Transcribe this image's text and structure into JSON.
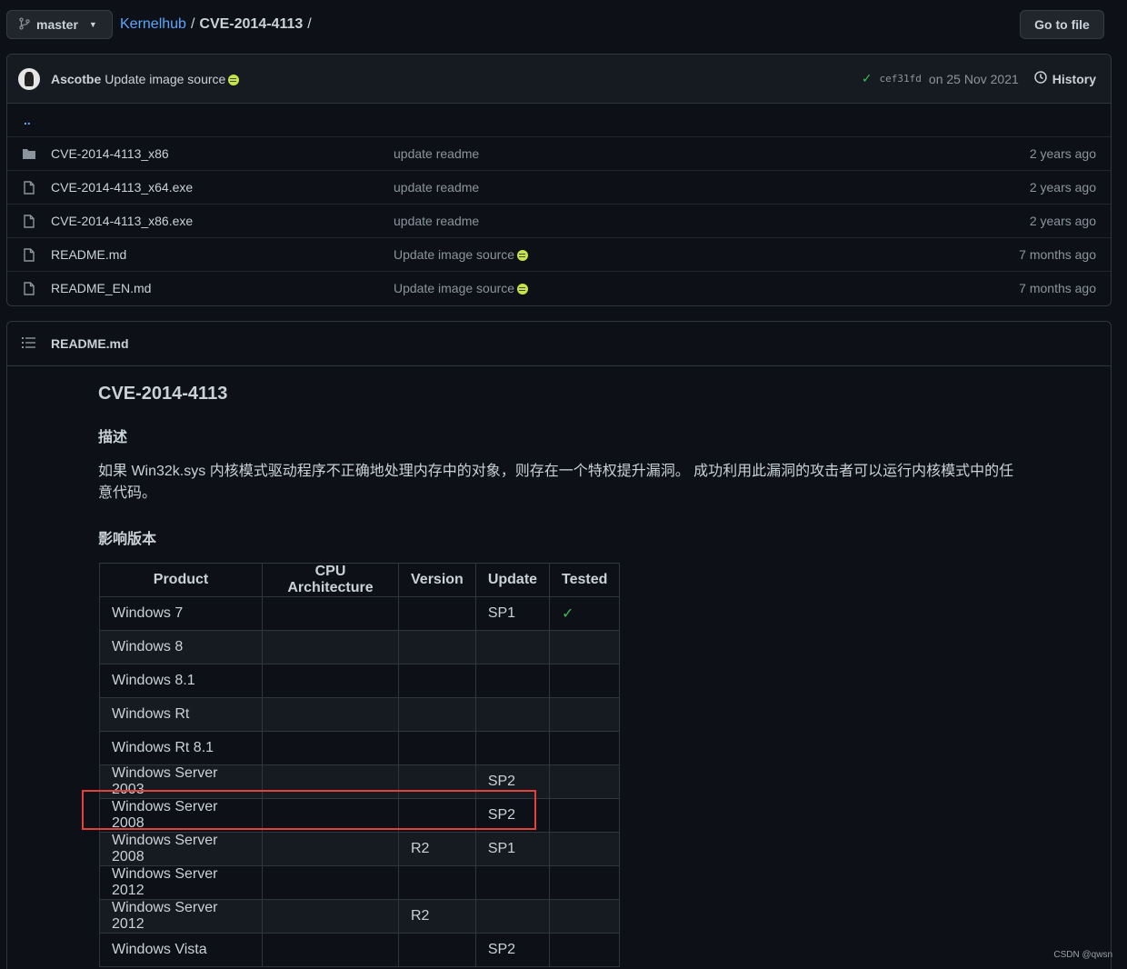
{
  "topbar": {
    "branch": "master",
    "repo": "Kernelhub",
    "folder": "CVE-2014-4113",
    "sep1": "/",
    "sep2": "/",
    "goto_label": "Go to file"
  },
  "commit": {
    "author": "Ascotbe",
    "message": "Update image source",
    "sha": "cef31fd",
    "date": "on 25 Nov 2021",
    "history_label": "History"
  },
  "files": {
    "parent_link": "..",
    "items": [
      {
        "name": "CVE-2014-4113_x86",
        "type": "folder",
        "message": "update readme",
        "age": "2 years ago"
      },
      {
        "name": "CVE-2014-4113_x64.exe",
        "type": "file",
        "message": "update readme",
        "age": "2 years ago"
      },
      {
        "name": "CVE-2014-4113_x86.exe",
        "type": "file",
        "message": "update readme",
        "age": "2 years ago"
      },
      {
        "name": "README.md",
        "type": "file",
        "message": "Update image source",
        "age": "7 months ago"
      },
      {
        "name": "README_EN.md",
        "type": "file",
        "message": "Update image source",
        "age": "7 months ago"
      }
    ]
  },
  "readme": {
    "filename": "README.md",
    "title": "CVE-2014-4113",
    "desc_heading": "描述",
    "desc_text": "如果 Win32k.sys 内核模式驱动程序不正确地处理内存中的对象，则存在一个特权提升漏洞。 成功利用此漏洞的攻击者可以运行内核模式中的任意代码。",
    "versions_heading": "影响版本",
    "table": {
      "headers": [
        "Product",
        "CPU Architecture",
        "Version",
        "Update",
        "Tested"
      ],
      "rows": [
        [
          "Windows 7",
          "",
          "",
          "SP1",
          "✓"
        ],
        [
          "Windows 8",
          "",
          "",
          "",
          ""
        ],
        [
          "Windows 8.1",
          "",
          "",
          "",
          ""
        ],
        [
          "Windows Rt",
          "",
          "",
          "",
          ""
        ],
        [
          "Windows Rt 8.1",
          "",
          "",
          "",
          ""
        ],
        [
          "Windows Server 2003",
          "",
          "",
          "SP2",
          ""
        ],
        [
          "Windows Server 2008",
          "",
          "",
          "SP2",
          ""
        ],
        [
          "Windows Server 2008",
          "",
          "R2",
          "SP1",
          ""
        ],
        [
          "Windows Server 2012",
          "",
          "",
          "",
          ""
        ],
        [
          "Windows Server 2012",
          "",
          "R2",
          "",
          ""
        ],
        [
          "Windows Vista",
          "",
          "",
          "SP2",
          ""
        ]
      ]
    }
  },
  "watermark": "CSDN @qwsn",
  "colors": {
    "accent": "#58a6ff",
    "success": "#3fb950",
    "highlight": "#e5403c",
    "background": "#0d1117"
  }
}
